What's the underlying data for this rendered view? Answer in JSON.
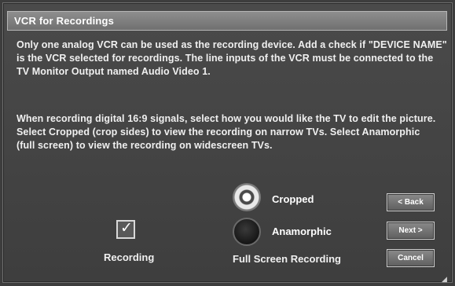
{
  "window": {
    "title": "VCR for Recordings"
  },
  "instructions": {
    "paragraph1": "Only one analog VCR can be used as the recording device.  Add a check if \"DEVICE NAME\" is the VCR selected for recordings.  The line inputs of the VCR must be connected to the TV Monitor Output named Audio Video 1.",
    "paragraph2": "When recording digital 16:9 signals, select how you would like the TV to edit the picture.  Select Cropped (crop sides) to view the recording on narrow TVs.  Select Anamorphic (full screen) to view the recording on widescreen TVs."
  },
  "recording": {
    "label": "Recording",
    "checked": true,
    "check_glyph": "✓"
  },
  "full_screen": {
    "label": "Full Screen Recording",
    "options": [
      {
        "label": "Cropped",
        "selected": true
      },
      {
        "label": "Anamorphic",
        "selected": false
      }
    ]
  },
  "buttons": {
    "back": "< Back",
    "next": "Next >",
    "cancel": "Cancel"
  },
  "icons": {
    "corner": "resize-grip-icon"
  }
}
